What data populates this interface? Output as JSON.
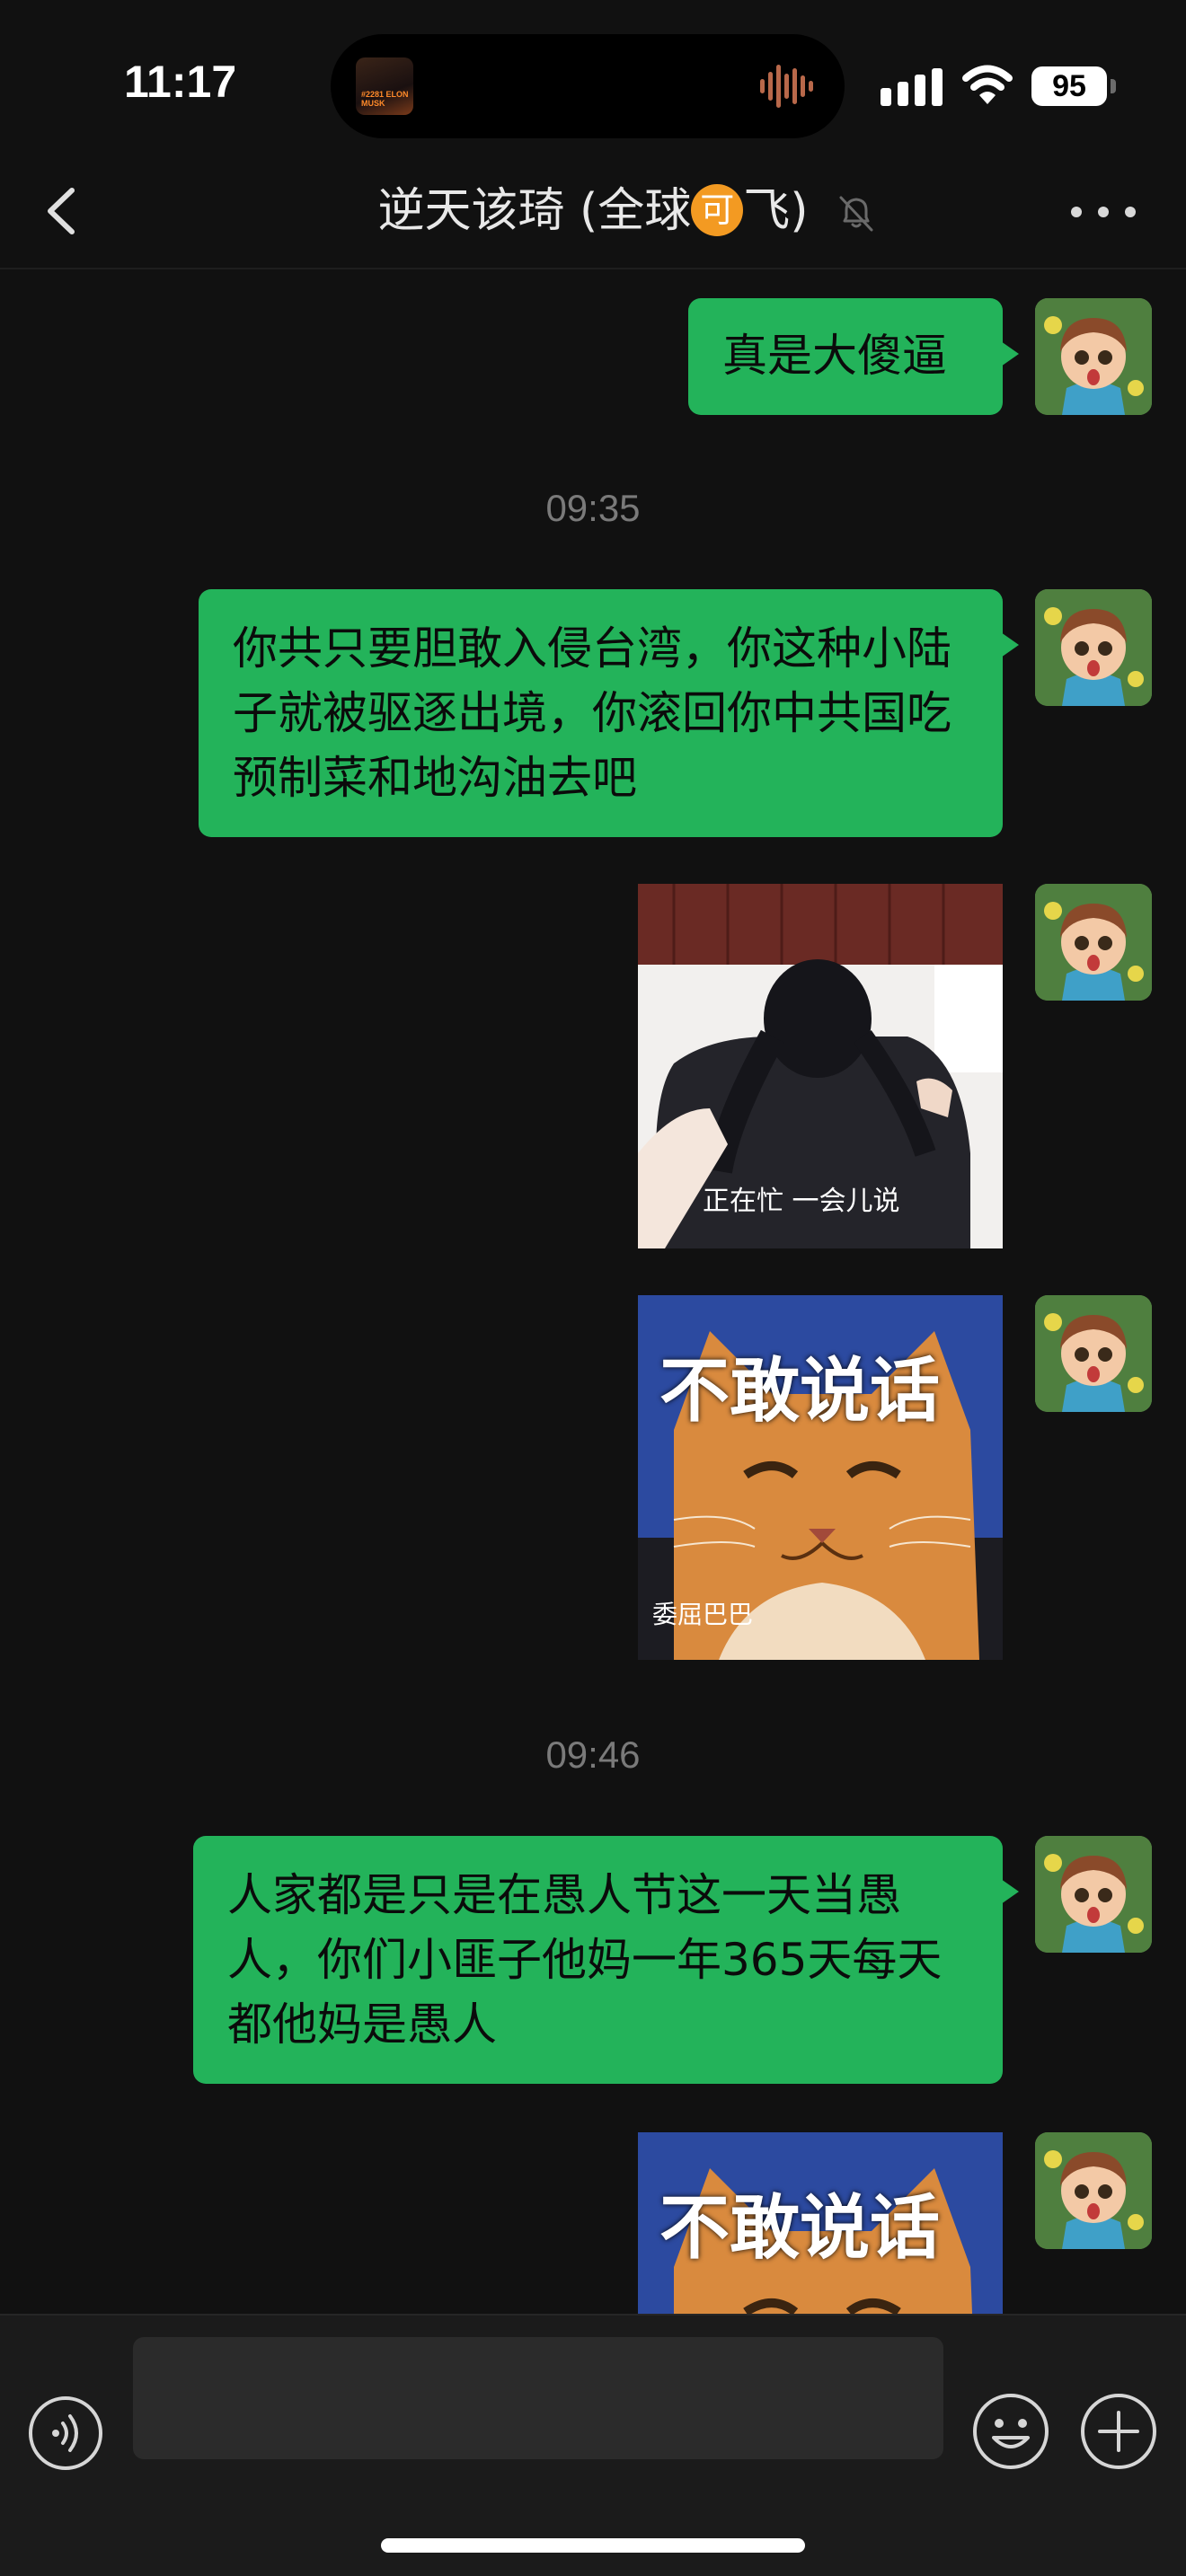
{
  "status_bar": {
    "time": "11:17",
    "battery": "95",
    "now_playing_art_text": "#2281 ELON MUSK"
  },
  "header": {
    "back_icon": "chevron-left-icon",
    "title_before": "逆天该琦 (全球",
    "title_badge": "可",
    "title_after": "飞)",
    "mute_icon": "bell-slash-icon",
    "more_icon": "more-dots-icon"
  },
  "messages": [
    {
      "type": "text",
      "sender": "me",
      "text": "真是大傻逼"
    },
    {
      "type": "timestamp",
      "text": "09:35"
    },
    {
      "type": "text",
      "sender": "me",
      "text": "你共只要胆敢入侵台湾，你这种小陆子就被驱逐出境，你滚回你中共国吃预制菜和地沟油去吧"
    },
    {
      "type": "sticker",
      "sender": "me",
      "caption": "正在忙 一会儿说"
    },
    {
      "type": "sticker",
      "sender": "me",
      "caption": "不敢说话",
      "subcaption": "委屈巴巴"
    },
    {
      "type": "timestamp",
      "text": "09:46"
    },
    {
      "type": "text",
      "sender": "me",
      "text": "人家都是只是在愚人节这一天当愚人，你们小匪子他妈一年365天每天都他妈是愚人"
    },
    {
      "type": "sticker",
      "sender": "me",
      "caption": "不敢说话"
    }
  ],
  "input_bar": {
    "voice_icon": "voice-input-icon",
    "text_value": "",
    "emoji_icon": "emoji-icon",
    "plus_icon": "plus-circle-icon"
  },
  "colors": {
    "background": "#111111",
    "bubble_self": "#23b35a",
    "timestamp": "#7a7a7a",
    "badge": "#f39a22"
  }
}
